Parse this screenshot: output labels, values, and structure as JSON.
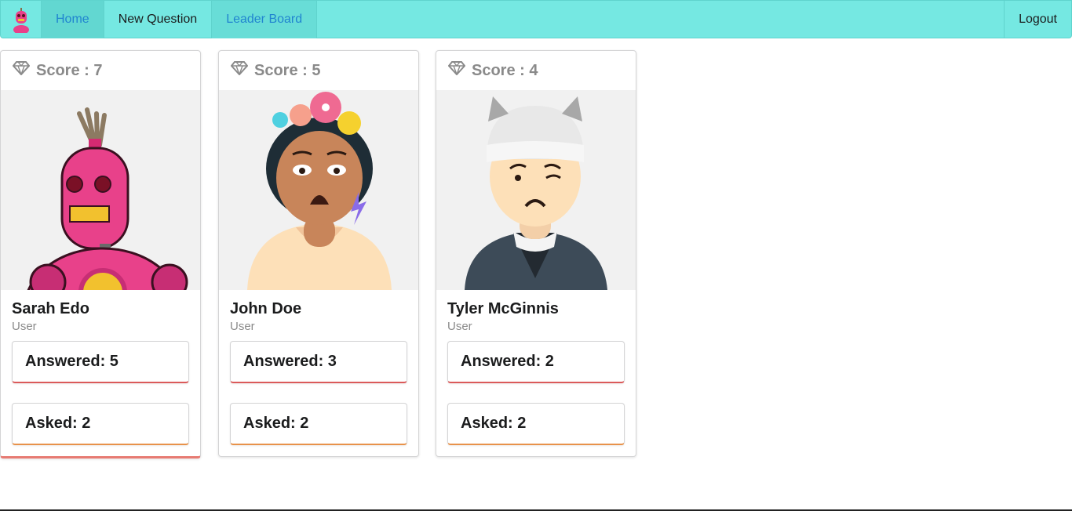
{
  "nav": {
    "logo_icon": "robot-logo-icon",
    "home_label": "Home",
    "new_question_label": "New Question",
    "leader_board_label": "Leader Board",
    "logout_label": "Logout",
    "bar_color": "#75e8e2",
    "link_color": "#2185d0"
  },
  "users": [
    {
      "score_label": "Score : 7",
      "name": "Sarah Edo",
      "role": "User",
      "answered_label": "Answered: 5",
      "asked_label": "Asked: 2",
      "avatar_icon": "pink-robot-avatar"
    },
    {
      "score_label": "Score : 5",
      "name": "John Doe",
      "role": "User",
      "answered_label": "Answered: 3",
      "asked_label": "Asked: 2",
      "avatar_icon": "flower-crown-avatar"
    },
    {
      "score_label": "Score : 4",
      "name": "Tyler McGinnis",
      "role": "User",
      "answered_label": "Answered: 2",
      "asked_label": "Asked: 2",
      "avatar_icon": "beanie-avatar"
    }
  ]
}
